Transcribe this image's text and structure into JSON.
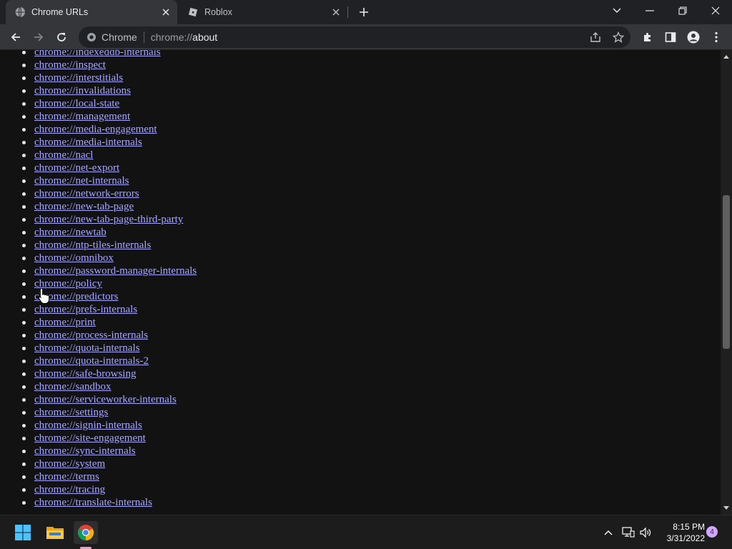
{
  "tabs": [
    {
      "title": "Chrome URLs",
      "favicon": "globe-icon",
      "active": true
    },
    {
      "title": "Roblox",
      "favicon": "roblox-icon",
      "active": false
    }
  ],
  "omnibox": {
    "chip": "Chrome",
    "scheme": "chrome://",
    "host": "about"
  },
  "page": {
    "links": [
      "chrome://indexeddb-internals",
      "chrome://inspect",
      "chrome://interstitials",
      "chrome://invalidations",
      "chrome://local-state",
      "chrome://management",
      "chrome://media-engagement",
      "chrome://media-internals",
      "chrome://nacl",
      "chrome://net-export",
      "chrome://net-internals",
      "chrome://network-errors",
      "chrome://new-tab-page",
      "chrome://new-tab-page-third-party",
      "chrome://newtab",
      "chrome://ntp-tiles-internals",
      "chrome://omnibox",
      "chrome://password-manager-internals",
      "chrome://policy",
      "chrome://predictors",
      "chrome://prefs-internals",
      "chrome://print",
      "chrome://process-internals",
      "chrome://quota-internals",
      "chrome://quota-internals-2",
      "chrome://safe-browsing",
      "chrome://sandbox",
      "chrome://serviceworker-internals",
      "chrome://settings",
      "chrome://signin-internals",
      "chrome://site-engagement",
      "chrome://sync-internals",
      "chrome://system",
      "chrome://terms",
      "chrome://tracing",
      "chrome://translate-internals"
    ]
  },
  "taskbar": {
    "time": "8:15 PM",
    "date": "3/31/2022",
    "notification_count": "4"
  },
  "colors": {
    "link": "#a8a8ff",
    "page_background": "#121212",
    "toolbar": "#35363a",
    "tabstrip": "#202124"
  }
}
